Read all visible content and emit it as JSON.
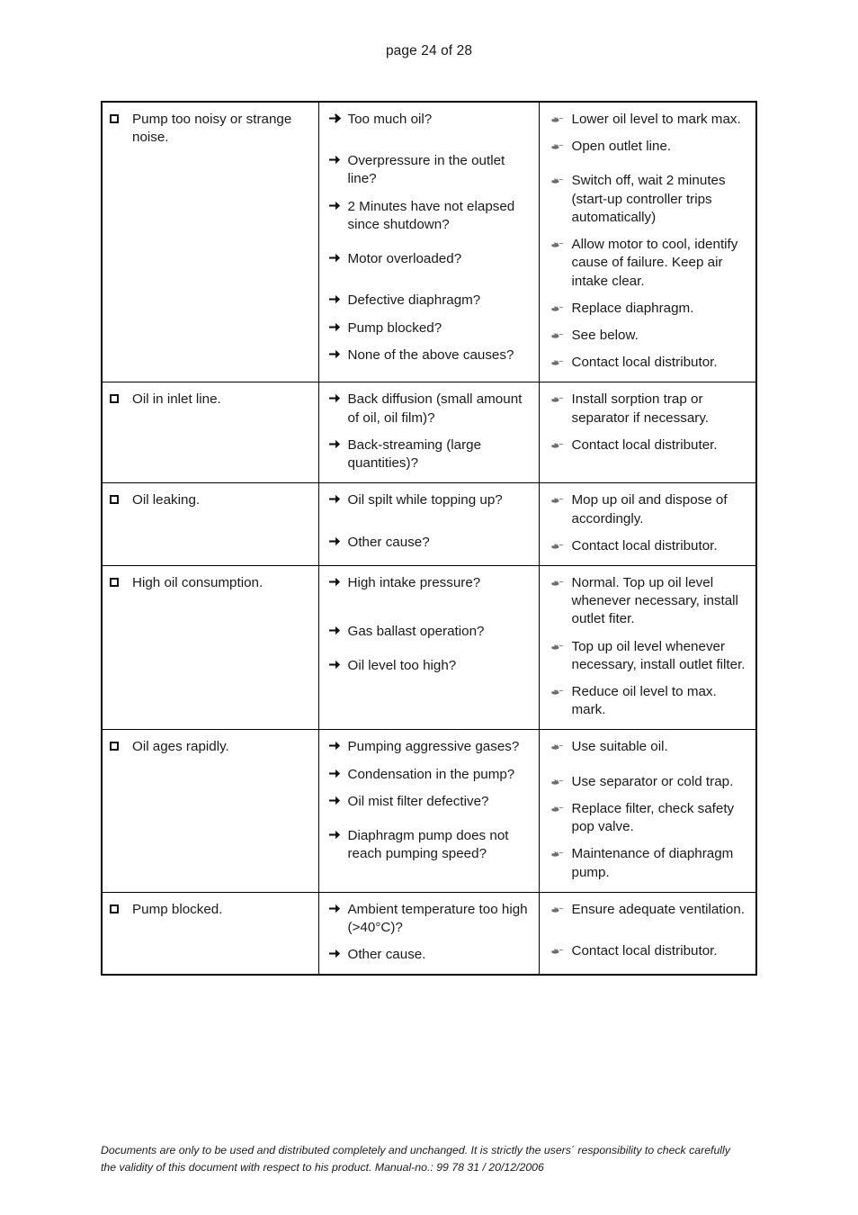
{
  "header": {
    "page_label": "page 24 of 28"
  },
  "icons": {
    "col1_bullet": "hollow-square-bullet-icon",
    "col2_bullet": "right-arrow-bullet-icon",
    "col3_bullet": "pointing-hand-bullet-icon"
  },
  "table": {
    "rows": [
      {
        "problem": "Pump too noisy or strange noise.",
        "causes": [
          "Too much oil?",
          "Overpressure in the outlet line?",
          "2 Minutes have not elapsed since shutdown?",
          "Motor overloaded?",
          "Defective diaphragm?",
          "Pump blocked?",
          "None of the above causes?"
        ],
        "remedies": [
          "Lower oil level to mark max.",
          "Open outlet line.",
          "Switch off, wait 2 minutes (start-up controller trips automatically)",
          "Allow motor to cool, identify cause of failure. Keep air intake clear.",
          "Replace diaphragm.",
          "See below.",
          "Contact local distributor."
        ]
      },
      {
        "problem": "Oil in inlet line.",
        "causes": [
          "Back diffusion (small amount of oil, oil film)?",
          "Back-streaming (large quantities)?"
        ],
        "remedies": [
          "Install sorption trap or separator if necessary.",
          "Contact local distributer."
        ]
      },
      {
        "problem": "Oil leaking.",
        "causes": [
          "Oil spilt while topping up?",
          "Other cause?"
        ],
        "remedies": [
          "Mop up oil and dispose of accordingly.",
          "Contact local distributor."
        ]
      },
      {
        "problem": "High oil consumption.",
        "causes": [
          "High intake pressure?",
          "Gas ballast operation?",
          "Oil level too high?"
        ],
        "remedies": [
          "Normal. Top up oil level whenever necessary, install outlet fiter.",
          "Top up oil level whenever necessary, install outlet filter.",
          "Reduce oil level to max. mark."
        ]
      },
      {
        "problem": "Oil ages rapidly.",
        "causes": [
          "Pumping aggressive gases?",
          "Condensation in the pump?",
          "Oil mist filter defective?",
          "Diaphragm pump does not reach pumping speed?"
        ],
        "remedies": [
          "Use suitable oil.",
          "Use separator or cold trap.",
          "Replace filter, check safety pop valve.",
          "Maintenance of diaphragm pump."
        ]
      },
      {
        "problem": "Pump blocked.",
        "causes": [
          "Ambient temperature too high (>40°C)?",
          "Other cause."
        ],
        "remedies": [
          "Ensure adequate ventilation.",
          "Contact local distributor."
        ]
      }
    ]
  },
  "footer": {
    "line1": "Documents are only to be used and distributed completely and unchanged. It is strictly the users´ responsibility to check carefully",
    "line2": "the validity of this document with respect to his product. Manual-no.: 99 78 31 / 20/12/2006"
  }
}
